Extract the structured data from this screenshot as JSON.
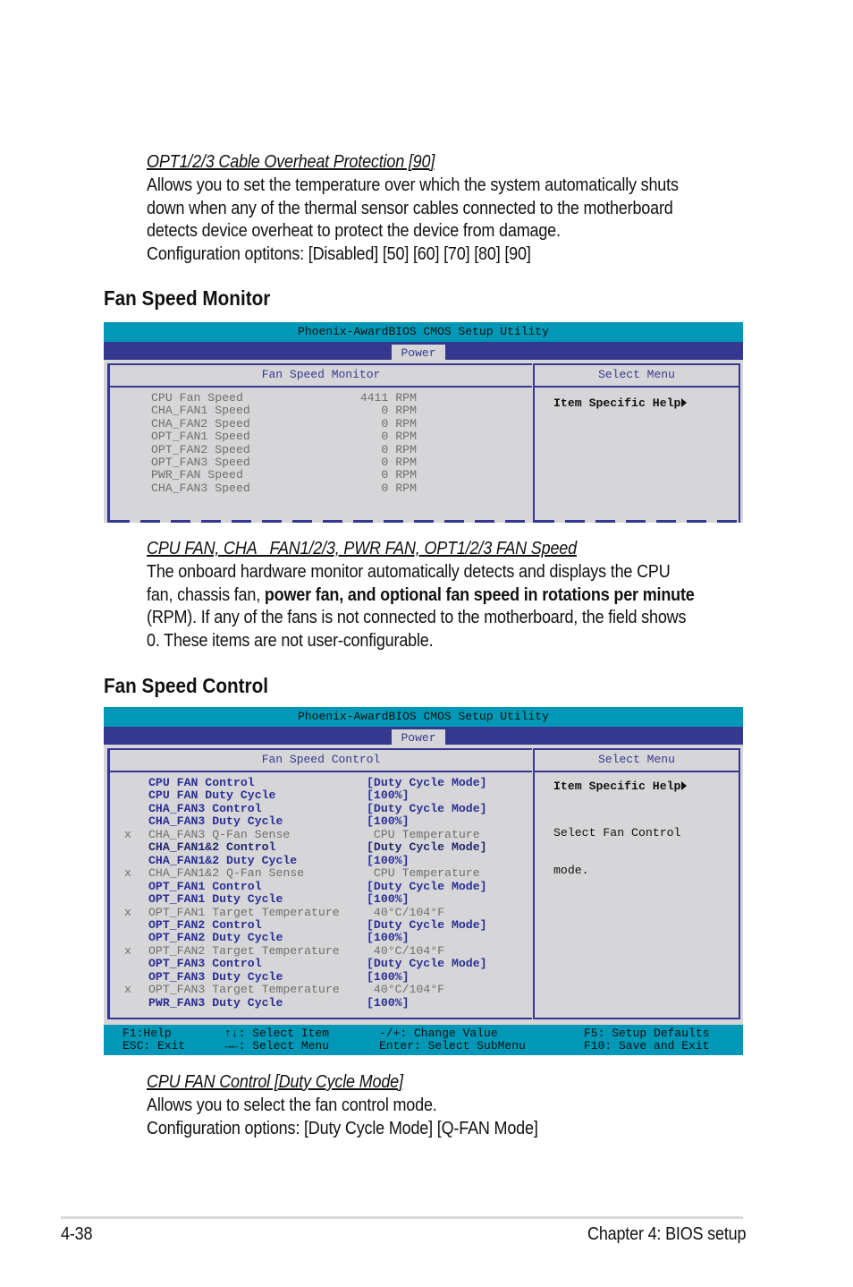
{
  "opt_cable": {
    "title": "OPT1/2/3 Cable Overheat Protection [90]",
    "lines": [
      "Allows you to set the temperature over which the system automatically shuts",
      "down when any of the thermal sensor cables connected to the motherboard",
      "detects device overheat to protect the device from damage.",
      "Configuration optitons: [Disabled] [50] [60] [70] [80] [90]"
    ]
  },
  "fan_speed_monitor": {
    "heading": "Fan Speed Monitor",
    "bios": {
      "title": "Phoenix-AwardBIOS CMOS Setup Utility",
      "tab": "Power",
      "left_header": "Fan Speed Monitor",
      "right_header": "Select Menu",
      "help": "Item Specific Help",
      "rows": [
        {
          "label": "CPU Fan Speed",
          "value": "4411 RPM"
        },
        {
          "label": "CHA_FAN1 Speed",
          "value": "0 RPM"
        },
        {
          "label": "CHA_FAN2 Speed",
          "value": "0 RPM"
        },
        {
          "label": "OPT_FAN1 Speed",
          "value": "0 RPM"
        },
        {
          "label": "OPT_FAN2 Speed",
          "value": "0 RPM"
        },
        {
          "label": "OPT_FAN3 Speed",
          "value": "0 RPM"
        },
        {
          "label": "PWR_FAN Speed",
          "value": "0 RPM"
        },
        {
          "label": "CHA_FAN3 Speed",
          "value": "0 RPM"
        }
      ]
    }
  },
  "fan_speed_desc": {
    "title": "CPU FAN, CHA _FAN1/2/3, PWR FAN, OPT1/2/3 FAN Speed",
    "line1": "The onboard hardware monitor automatically detects and displays the CPU",
    "line2a": "fan, chassis fan, ",
    "line2b": "power fan, and optional fan speed in rotations per minute",
    "line3": "(RPM). If any of the fans is not connected to the motherboard, the field shows",
    "line4": "0. These items are not user-configurable."
  },
  "fan_speed_control": {
    "heading": "Fan Speed Control",
    "bios": {
      "title": "Phoenix-AwardBIOS CMOS Setup Utility",
      "tab": "Power",
      "left_header": "Fan Speed Control",
      "right_header": "Select Menu",
      "help": "Item Specific Help",
      "help_desc_1": "Select Fan Control",
      "help_desc_2": "mode.",
      "rows": [
        {
          "mark": "",
          "label": "CPU FAN Control",
          "value": "[Duty Cycle Mode]",
          "state": "normal"
        },
        {
          "mark": "",
          "label": "CPU FAN Duty Cycle",
          "value": "[100%]",
          "state": "normal"
        },
        {
          "mark": "",
          "label": "CHA_FAN3 Control",
          "value": "[Duty Cycle Mode]",
          "state": "normal"
        },
        {
          "mark": "",
          "label": "CHA_FAN3 Duty Cycle",
          "value": "[100%]",
          "state": "normal"
        },
        {
          "mark": "x",
          "label": "CHA_FAN3 Q-Fan Sense",
          "value": " CPU Temperature",
          "state": "disabled"
        },
        {
          "mark": "",
          "label": "CHA_FAN1&2 Control",
          "value": "[Duty Cycle Mode]",
          "state": "selected"
        },
        {
          "mark": "",
          "label": "CHA_FAN1&2 Duty Cycle",
          "value": "[100%]",
          "state": "normal"
        },
        {
          "mark": "x",
          "label": "CHA_FAN1&2 Q-Fan Sense",
          "value": " CPU Temperature",
          "state": "disabled"
        },
        {
          "mark": "",
          "label": "OPT_FAN1 Control",
          "value": "[Duty Cycle Mode]",
          "state": "normal"
        },
        {
          "mark": "",
          "label": "OPT_FAN1 Duty Cycle",
          "value": "[100%]",
          "state": "normal"
        },
        {
          "mark": "x",
          "label": "OPT_FAN1 Target Temperature",
          "value": " 40°C/104°F",
          "state": "disabled"
        },
        {
          "mark": "",
          "label": "OPT_FAN2 Control",
          "value": "[Duty Cycle Mode]",
          "state": "normal"
        },
        {
          "mark": "",
          "label": "OPT_FAN2 Duty Cycle",
          "value": "[100%]",
          "state": "normal"
        },
        {
          "mark": "x",
          "label": "OPT_FAN2 Target Temperature",
          "value": " 40°C/104°F",
          "state": "disabled"
        },
        {
          "mark": "",
          "label": "OPT_FAN3 Control",
          "value": "[Duty Cycle Mode]",
          "state": "normal"
        },
        {
          "mark": "",
          "label": "OPT_FAN3 Duty Cycle",
          "value": "[100%]",
          "state": "normal"
        },
        {
          "mark": "x",
          "label": "OPT_FAN3 Target Temperature",
          "value": " 40°C/104°F",
          "state": "disabled"
        },
        {
          "mark": "",
          "label": "PWR_FAN3 Duty Cycle",
          "value": "[100%]",
          "state": "normal"
        }
      ],
      "footer": {
        "f1": "F1:Help",
        "esc": "ESC: Exit",
        "updown": "↑↓: Select Item",
        "leftright": "→←: Select Menu",
        "change": "-/+: Change Value",
        "enter": "Enter: Select SubMenu",
        "f5": "F5: Setup Defaults",
        "f10": "F10: Save and Exit"
      }
    }
  },
  "cpu_fan_control": {
    "title": "CPU FAN Control [Duty Cycle Mode]",
    "line1": "Allows you to select the fan control mode.",
    "line2": "Configuration options: [Duty Cycle Mode] [Q-FAN Mode]"
  },
  "page_footer": {
    "page_number": "4-38",
    "chapter": "Chapter 4: BIOS setup"
  },
  "colors": {
    "bios_title_bar": "#0098b6",
    "bios_tab_bar": "#353890",
    "bios_panel": "#d6d6d8",
    "bios_item_text": "#2a2f94",
    "bios_disabled_text": "#6e6e6e"
  }
}
